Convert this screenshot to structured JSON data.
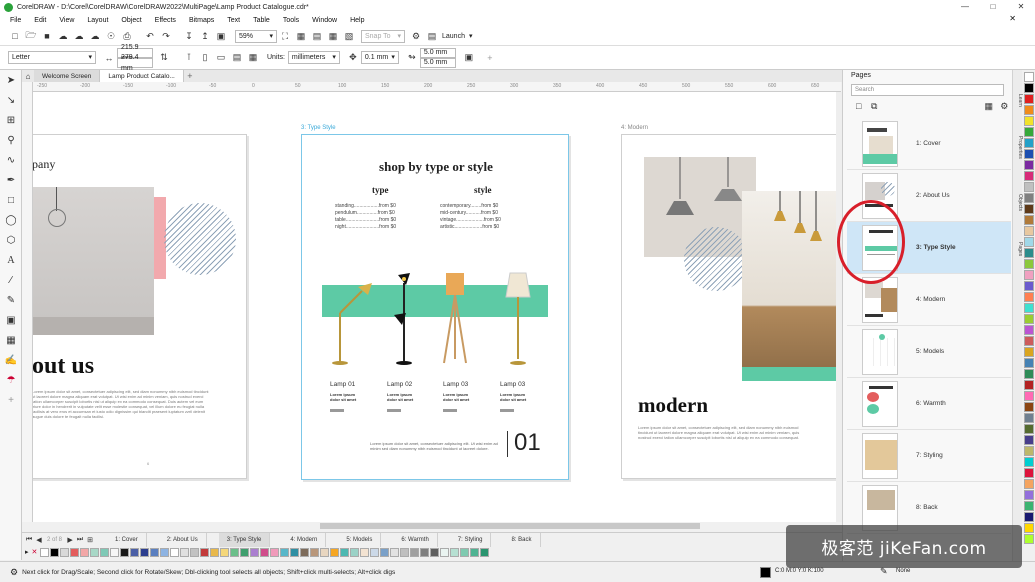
{
  "window": {
    "title": "CorelDRAW - D:\\Corel\\CorelDRAW\\CorelDRAW2022\\MultiPage\\Lamp Product Catalogue.cdr*"
  },
  "menu": [
    "File",
    "Edit",
    "View",
    "Layout",
    "Object",
    "Effects",
    "Bitmaps",
    "Text",
    "Table",
    "Tools",
    "Window",
    "Help"
  ],
  "toolbar": {
    "zoom": "59%",
    "snap_to": "Snap To",
    "launch": "Launch"
  },
  "propbar": {
    "paper": "Letter",
    "width": "215.9 mm",
    "height": "279.4 mm",
    "units_label": "Units:",
    "units": "millimeters",
    "nudge": "0.1 mm",
    "dup_x": "5.0 mm",
    "dup_y": "5.0 mm"
  },
  "doc_tabs": [
    "Welcome Screen",
    "Lamp Product Catalo..."
  ],
  "ruler_ticks": [
    "-250",
    "-200",
    "-150",
    "-100",
    "-50",
    "0",
    "50",
    "100",
    "150",
    "200",
    "250",
    "300",
    "350",
    "400",
    "450",
    "500",
    "550",
    "600",
    "650"
  ],
  "canvas": {
    "page2": {
      "heading_partial": "pany",
      "about_title": "out us",
      "body": "Lorem ipsum dolor sit amet, consectetuer adipiscing elit, sed diam nonummy nibh euismod tincidunt ut laoreet dolore magna aliquam erat volutpat. Ut wisi enim ad minim veniam, quis nostrud exerci tation ullamcorper suscipit lobortis nisl ut aliquip ex ea commodo consequat. Duis autem vel eum iriure dolor in hendrerit in vulputate velit esse molestie consequat, vel illum dolore eu feugiat nulla facilisis at vero eros et accumsan et iusto odio dignissim qui blandit praesent luptatum zzril delenit augue duis dolore te feugait nulla facilisi.",
      "page_num": "6"
    },
    "page3": {
      "tag": "3: Type Style",
      "heading": "shop by type or style",
      "col_type": "type",
      "col_style": "style",
      "type_list": [
        "standing..................from $0",
        "pendulum...............from $0",
        "table........................from $0",
        "night........................from $0"
      ],
      "style_list": [
        "contemporary........from $0",
        "mid-century...........from $0",
        "vintage....................from $0",
        "artistic....................from $0"
      ],
      "lamps": [
        "Lamp 01",
        "Lamp 02",
        "Lamp 03",
        "Lamp 03"
      ],
      "lamp_desc": "Lorem ipsum dolor sit amet",
      "footer_text": "Lorem ipsum dolor sit amet, consectetuer adipiscing elit. Ut wisi enim ad minim sed diam nonummy nibh euismod tincidunt ut laoreet dolore.",
      "page_big": "01"
    },
    "page4": {
      "tag": "4: Modern",
      "title": "modern",
      "body": "Lorem ipsum dolor sit amet, consectetuer adipiscing elit, sed diam nonummy nibh euismod tincidunt ut laoreet dolore magna aliquam erat volutpat. Ut wisi enim ad minim veniam, quis nostrud exerci tation ullamcorper suscipit lobortis nisl ut aliquip ex ea commodo consequat."
    }
  },
  "page_nav": {
    "counter": "2 of 8",
    "tabs": [
      "1: Cover",
      "2: About Us",
      "3: Type Style",
      "4: Modern",
      "5: Models",
      "6: Warmth",
      "7: Styling",
      "8: Back"
    ],
    "active": 2
  },
  "docker": {
    "title": "Pages",
    "search_placeholder": "Search",
    "pages": [
      "1: Cover",
      "2: About Us",
      "3: Type Style",
      "4: Modern",
      "5: Models",
      "6: Warmth",
      "7: Styling",
      "8: Back"
    ],
    "active": 2
  },
  "right_tabs": [
    "Learn",
    "Properties",
    "Objects",
    "Pages"
  ],
  "status": {
    "hint": "Next click for Drag/Scale; Second click for Rotate/Skew; Dbl-clicking tool selects all objects; Shift+click multi-selects; Alt+click digs",
    "fill": "C:0 M:0 Y:0 K:100",
    "outline": "None"
  },
  "palette": [
    "#ffffff",
    "#000000",
    "#d9d9d9",
    "#e35d5d",
    "#f2a7a7",
    "#a8d8c7",
    "#7fc9b6",
    "#f7f7f7",
    "#1a1a1a",
    "#4b5fa6",
    "#2c3e8f",
    "#5a7fc0",
    "#8db3e2",
    "#ffffff",
    "#e0e0e0",
    "#c2c2c2",
    "#c23a3a",
    "#e8b84b",
    "#f4d77a",
    "#6bbf8a",
    "#3f9f6e",
    "#aa7ecf",
    "#d04d8b",
    "#f09aba",
    "#58b7c9",
    "#2f8fa3",
    "#7d6b5a",
    "#b8967a",
    "#e8d6c0",
    "#f5a623",
    "#4cb8b1",
    "#9bd2c7",
    "#f3e3d2",
    "#ccd9e8",
    "#7aa0c8",
    "#e2e2e2",
    "#bfbfbf",
    "#a0a0a0",
    "#7f7f7f",
    "#5e5e5e",
    "#eaf4f1",
    "#b6e0d2",
    "#7fcab0",
    "#4fb392",
    "#2a946f"
  ],
  "right_palette": [
    "#ffffff",
    "#000000",
    "#e02020",
    "#f08c1c",
    "#f2e22c",
    "#36a83a",
    "#24a0c8",
    "#1c4fb0",
    "#7a2aa0",
    "#d72a78",
    "#c0c0c0",
    "#808080",
    "#5e3a1a",
    "#b07a3a",
    "#e8c8a0",
    "#a0d8e8",
    "#2c8c8c",
    "#8cc83c",
    "#f0a0c0",
    "#6a5acd",
    "#ff7f50",
    "#40e0d0",
    "#9acd32",
    "#ba55d3",
    "#cd5c5c",
    "#daa520",
    "#4682b4",
    "#2e8b57",
    "#b22222",
    "#ff69b4",
    "#8b4513",
    "#708090",
    "#556b2f",
    "#483d8b",
    "#bdb76b",
    "#00ced1",
    "#dc143c",
    "#f4a460",
    "#9370db",
    "#3cb371",
    "#191970",
    "#ffd700",
    "#adff2f"
  ],
  "watermark": "极客范 jiKeFan.com",
  "colors": {
    "accent_teal": "#5dcaa5",
    "select_red": "#d81f2a",
    "active_blue": "#cfe6f7"
  }
}
